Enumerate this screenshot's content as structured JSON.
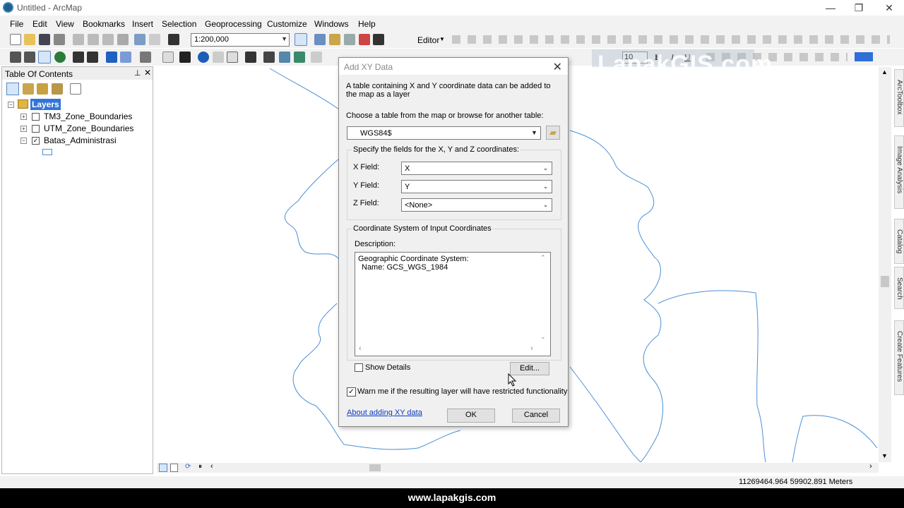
{
  "window": {
    "title": "Untitled - ArcMap"
  },
  "menu": [
    "File",
    "Edit",
    "View",
    "Bookmarks",
    "Insert",
    "Selection",
    "Geoprocessing",
    "Customize",
    "Windows",
    "Help"
  ],
  "toolbar": {
    "scale": "1:200,000",
    "editor_label": "Editor",
    "font_size": "10"
  },
  "toc": {
    "title": "Table Of Contents",
    "root": "Layers",
    "layers": [
      {
        "name": "TM3_Zone_Boundaries",
        "checked": false
      },
      {
        "name": "UTM_Zone_Boundaries",
        "checked": false
      },
      {
        "name": "Batas_Administrasi",
        "checked": true
      }
    ]
  },
  "dock_tabs": [
    "ArcToolbox",
    "Image Analysis",
    "Catalog",
    "Search",
    "Create Features"
  ],
  "dialog": {
    "title": "Add XY Data",
    "intro": "A table containing X and Y coordinate data can be added to the map as a layer",
    "choose_label": "Choose a table from the map or browse for another table:",
    "table_value": "WGS84$",
    "fields_label": "Specify the fields for the X, Y and Z coordinates:",
    "x_label": "X Field:",
    "x_value": "X",
    "y_label": "Y Field:",
    "y_value": "Y",
    "z_label": "Z Field:",
    "z_value": "<None>",
    "crs_group": "Coordinate System of Input Coordinates",
    "description_label": "Description:",
    "description_line1": "Geographic Coordinate System:",
    "description_line2": "Name: GCS_WGS_1984",
    "show_details": "Show Details",
    "edit_button": "Edit...",
    "warn_label": "Warn me if the resulting layer will have restricted functionality",
    "warn_checked": true,
    "about_link": "About adding XY data",
    "ok": "OK",
    "cancel": "Cancel"
  },
  "status": {
    "coords": "11269464.964  59902.891 Meters"
  },
  "watermark": "LapakGIS.com",
  "footer": "www.lapakgis.com",
  "colors": {
    "map_line": "#4a8fd6",
    "accent": "#1f5f8b"
  }
}
